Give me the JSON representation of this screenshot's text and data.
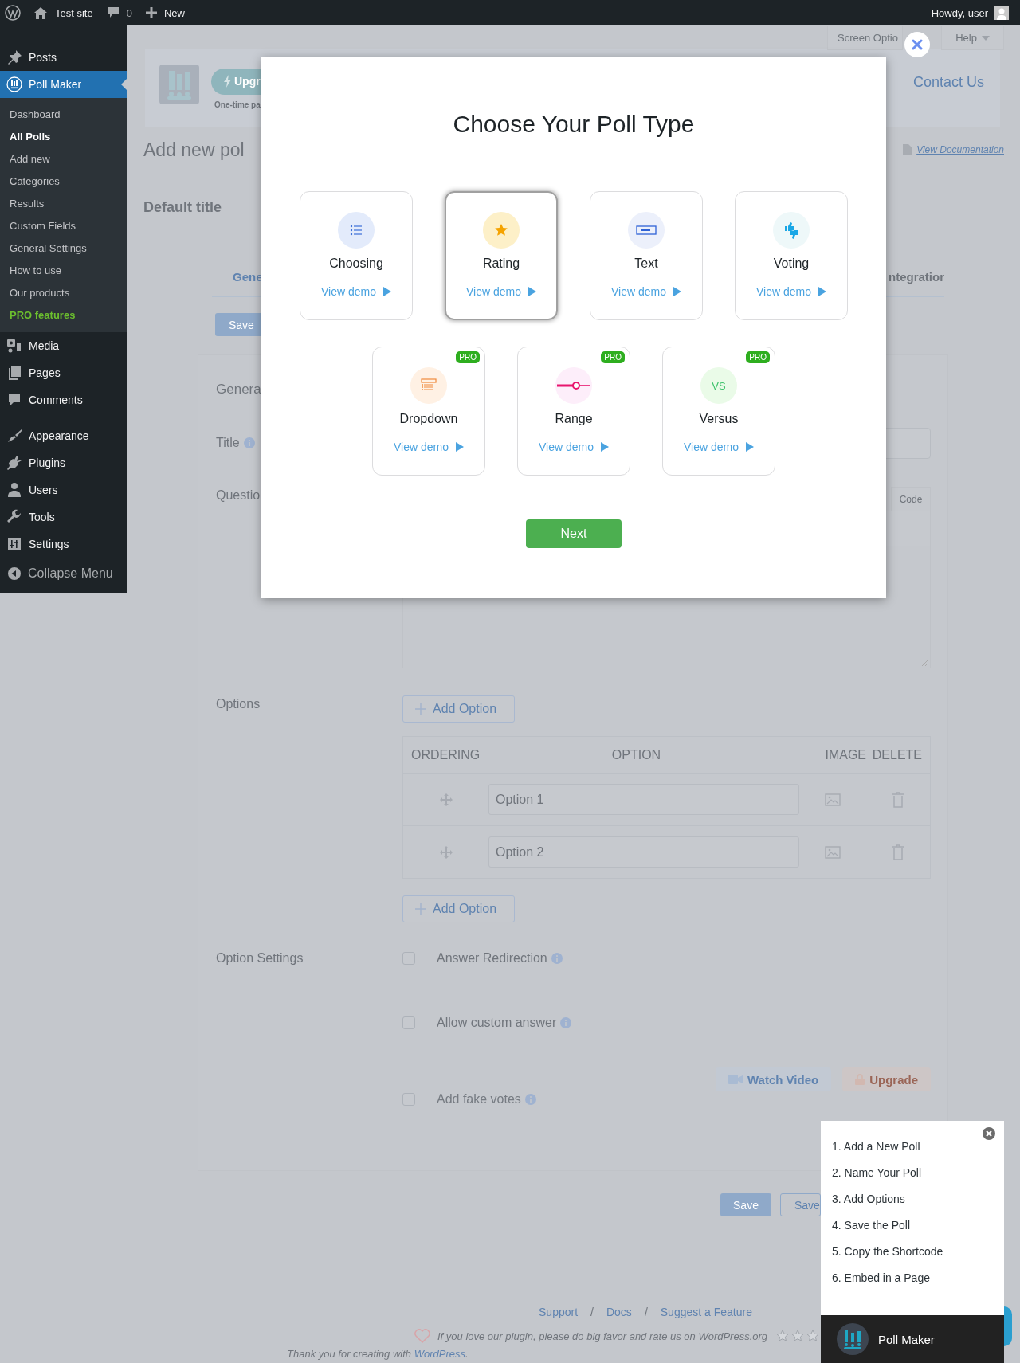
{
  "admin_bar": {
    "site_name": "Test site",
    "comment_count": "0",
    "new_label": "New",
    "greeting": "Howdy, user"
  },
  "sidebar": {
    "groups": [
      [
        {
          "label": "Posts",
          "selected": false
        },
        {
          "label": "Poll Maker",
          "selected": true,
          "children": [
            {
              "label": "Dashboard",
              "selected": false,
              "kind": "link"
            },
            {
              "label": "All Polls",
              "selected": true,
              "kind": "link"
            },
            {
              "label": "Add new",
              "selected": false,
              "kind": "link"
            },
            {
              "label": "Categories",
              "selected": false,
              "kind": "link"
            },
            {
              "label": "Results",
              "selected": false,
              "kind": "link"
            },
            {
              "label": "Custom Fields",
              "selected": false,
              "kind": "link"
            },
            {
              "label": "General Settings",
              "selected": false,
              "kind": "link"
            },
            {
              "label": "How to use",
              "selected": false,
              "kind": "link"
            },
            {
              "label": "Our products",
              "selected": false,
              "kind": "link"
            },
            {
              "label": "PRO features",
              "selected": false,
              "kind": "pro"
            }
          ]
        },
        {
          "label": "Media",
          "selected": false
        },
        {
          "label": "Pages",
          "selected": false
        },
        {
          "label": "Comments",
          "selected": false
        }
      ],
      [
        {
          "label": "Appearance",
          "selected": false
        },
        {
          "label": "Plugins",
          "selected": false
        },
        {
          "label": "Users",
          "selected": false
        },
        {
          "label": "Tools",
          "selected": false
        },
        {
          "label": "Settings",
          "selected": false
        }
      ]
    ],
    "collapse": "Collapse Menu"
  },
  "page": {
    "screen_options": "Screen Optio",
    "help": "Help",
    "header": {
      "upgrade": "Upgr",
      "upgrade_note": "One-time pa",
      "contact": "Contact Us"
    },
    "title": "Add new pol",
    "documentation": "View Documentation",
    "poll_title": "Default title",
    "tabs": [
      {
        "label": "Gene",
        "selected": true
      },
      {
        "label": "ntegratior",
        "selected": false
      }
    ],
    "save_top": "Save",
    "section_title": "Genera",
    "title_label": "Title",
    "question_label": "Questio",
    "editor_tab": "Code",
    "options_label": "Options",
    "add_option": "Add Option",
    "table": {
      "columns": [
        "ORDERING",
        "OPTION",
        "IMAGE",
        "DELETE"
      ],
      "rows": [
        {
          "placeholder": "Option 1"
        },
        {
          "placeholder": "Option 2"
        }
      ]
    },
    "add_option_bottom": "Add Option",
    "option_settings_label": "Option Settings",
    "settings": [
      {
        "label": "Answer Redirection",
        "checked": false
      },
      {
        "label": "Allow custom answer",
        "checked": false
      }
    ],
    "pro_setting": {
      "label": "Add fake votes",
      "checked": false,
      "watch_video": "Watch Video",
      "upgrade": "Upgrade"
    },
    "save": "Save",
    "save_secondary": "Save",
    "footer": {
      "links": [
        "Support",
        "Docs",
        "Suggest a Feature"
      ],
      "separator": "/",
      "rate_text": "If you love our plugin, please do big favor and rate us on WordPress.org",
      "stars": 0,
      "thanks": "Thank you for creating with",
      "thanks_link": "WordPress",
      "thanks_end": "."
    }
  },
  "modal": {
    "title": "Choose Your Poll Type",
    "types": [
      {
        "name": "Choosing",
        "link": "View demo",
        "selected": false
      },
      {
        "name": "Rating",
        "link": "View demo",
        "selected": true
      },
      {
        "name": "Text",
        "link": "View demo",
        "selected": false
      },
      {
        "name": "Voting",
        "link": "View demo",
        "selected": false
      },
      {
        "name": "Dropdown",
        "link": "View demo",
        "selected": false,
        "badge": "PRO"
      },
      {
        "name": "Range",
        "link": "View demo",
        "selected": false,
        "badge": "PRO"
      },
      {
        "name": "Versus",
        "link": "View demo",
        "selected": false,
        "badge": "PRO",
        "icon_text": "VS"
      }
    ],
    "next": "Next"
  },
  "guide": {
    "steps": [
      "1. Add a New Poll",
      "2. Name Your Poll",
      "3. Add Options",
      "4. Save the Poll",
      "5. Copy the Shortcode",
      "6. Embed in a Page"
    ],
    "brand": "Poll Maker"
  }
}
